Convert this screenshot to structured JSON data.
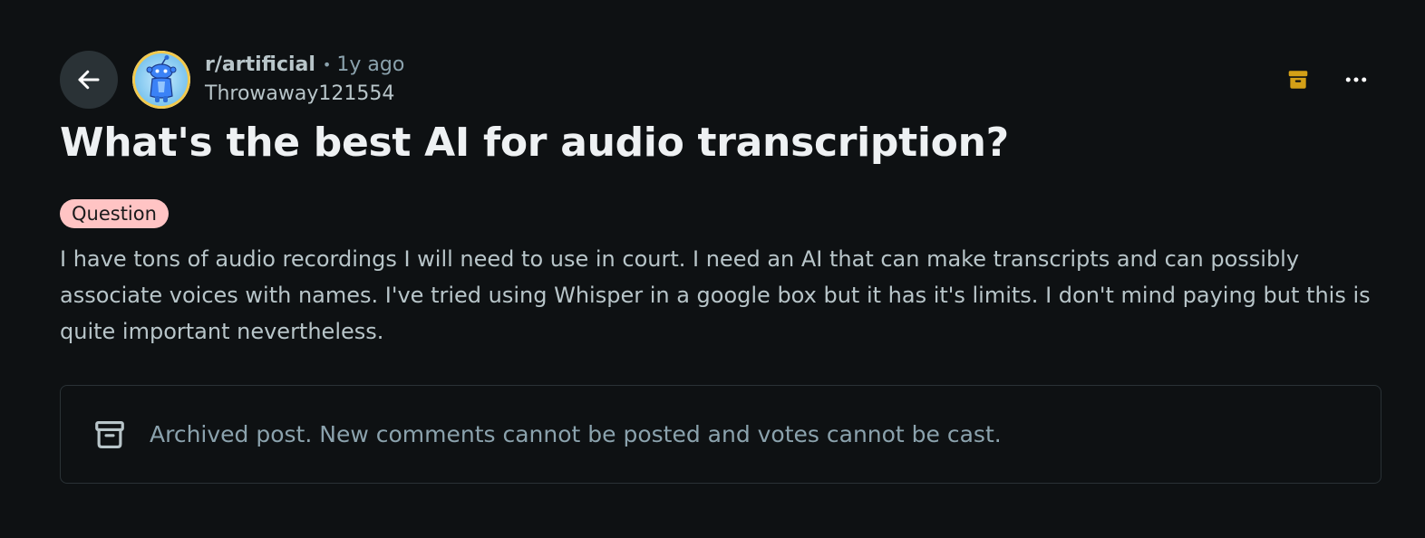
{
  "post": {
    "subreddit": "r/artificial",
    "separator": "•",
    "age": "1y ago",
    "author": "Throwaway121554",
    "title": "What's the best AI for audio transcription?",
    "flair": "Question",
    "body": "I have tons of audio recordings I will need to use in court. I need an AI that can make transcripts and can possibly associate voices with names. I've tried using Whisper in a google box but it has it's limits. I don't mind paying but this is quite important nevertheless."
  },
  "archived_notice": {
    "text": "Archived post. New comments cannot be posted and votes cannot be cast."
  },
  "icons": {
    "back": "arrow-left-icon",
    "avatar": "snoo-avatar-icon",
    "archive": "archive-box-icon",
    "more": "more-horizontal-icon"
  },
  "colors": {
    "background": "#0e1113",
    "flair_bg": "#ffc4c4",
    "archive_icon": "#d4a017",
    "muted_text": "#8ba2ad"
  }
}
